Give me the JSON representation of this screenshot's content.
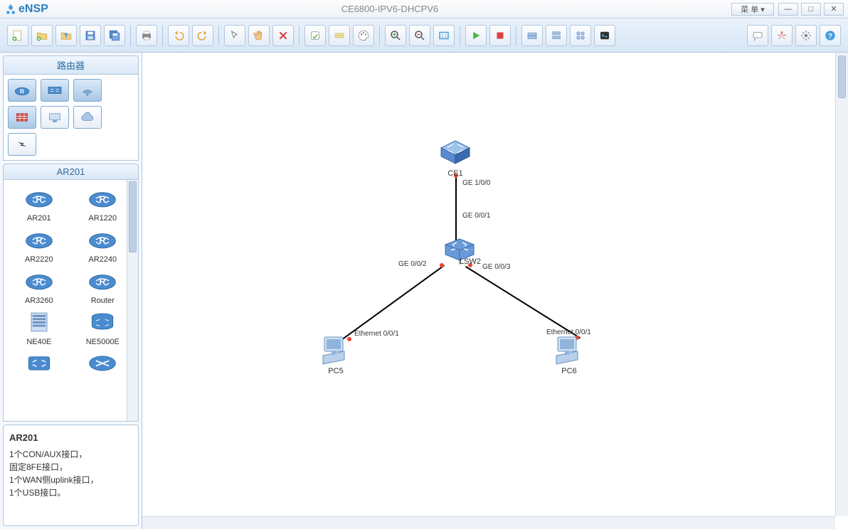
{
  "app": {
    "logo_text": "eNSP",
    "title": "CE6800-IPV6-DHCPV6",
    "menu_label": "菜 单 ▾"
  },
  "win": {
    "min": "—",
    "max": "□",
    "close": "✕"
  },
  "sidebar": {
    "category_header": "路由器",
    "selected_header": "AR201",
    "devices": [
      "AR201",
      "AR1220",
      "AR2220",
      "AR2240",
      "AR3260",
      "Router",
      "NE40E",
      "NE5000E"
    ],
    "info": {
      "name": "AR201",
      "desc": "1个CON/AUX接口，\n固定8FE接口，\n1个WAN侧uplink接口，\n1个USB接口。"
    }
  },
  "topology": {
    "nodes": {
      "ce1": {
        "label": "CE1"
      },
      "lsw2": {
        "label": "LSW2"
      },
      "pc5": {
        "label": "PC5"
      },
      "pc6": {
        "label": "PC6"
      }
    },
    "ports": {
      "ce1_down": "GE 1/0/0",
      "lsw2_up": "GE 0/0/1",
      "lsw2_left": "GE 0/0/2",
      "lsw2_right": "GE 0/0/3",
      "pc5_port": "Ethernet 0/0/1",
      "pc6_port": "Ethernet 0/0/1"
    }
  }
}
